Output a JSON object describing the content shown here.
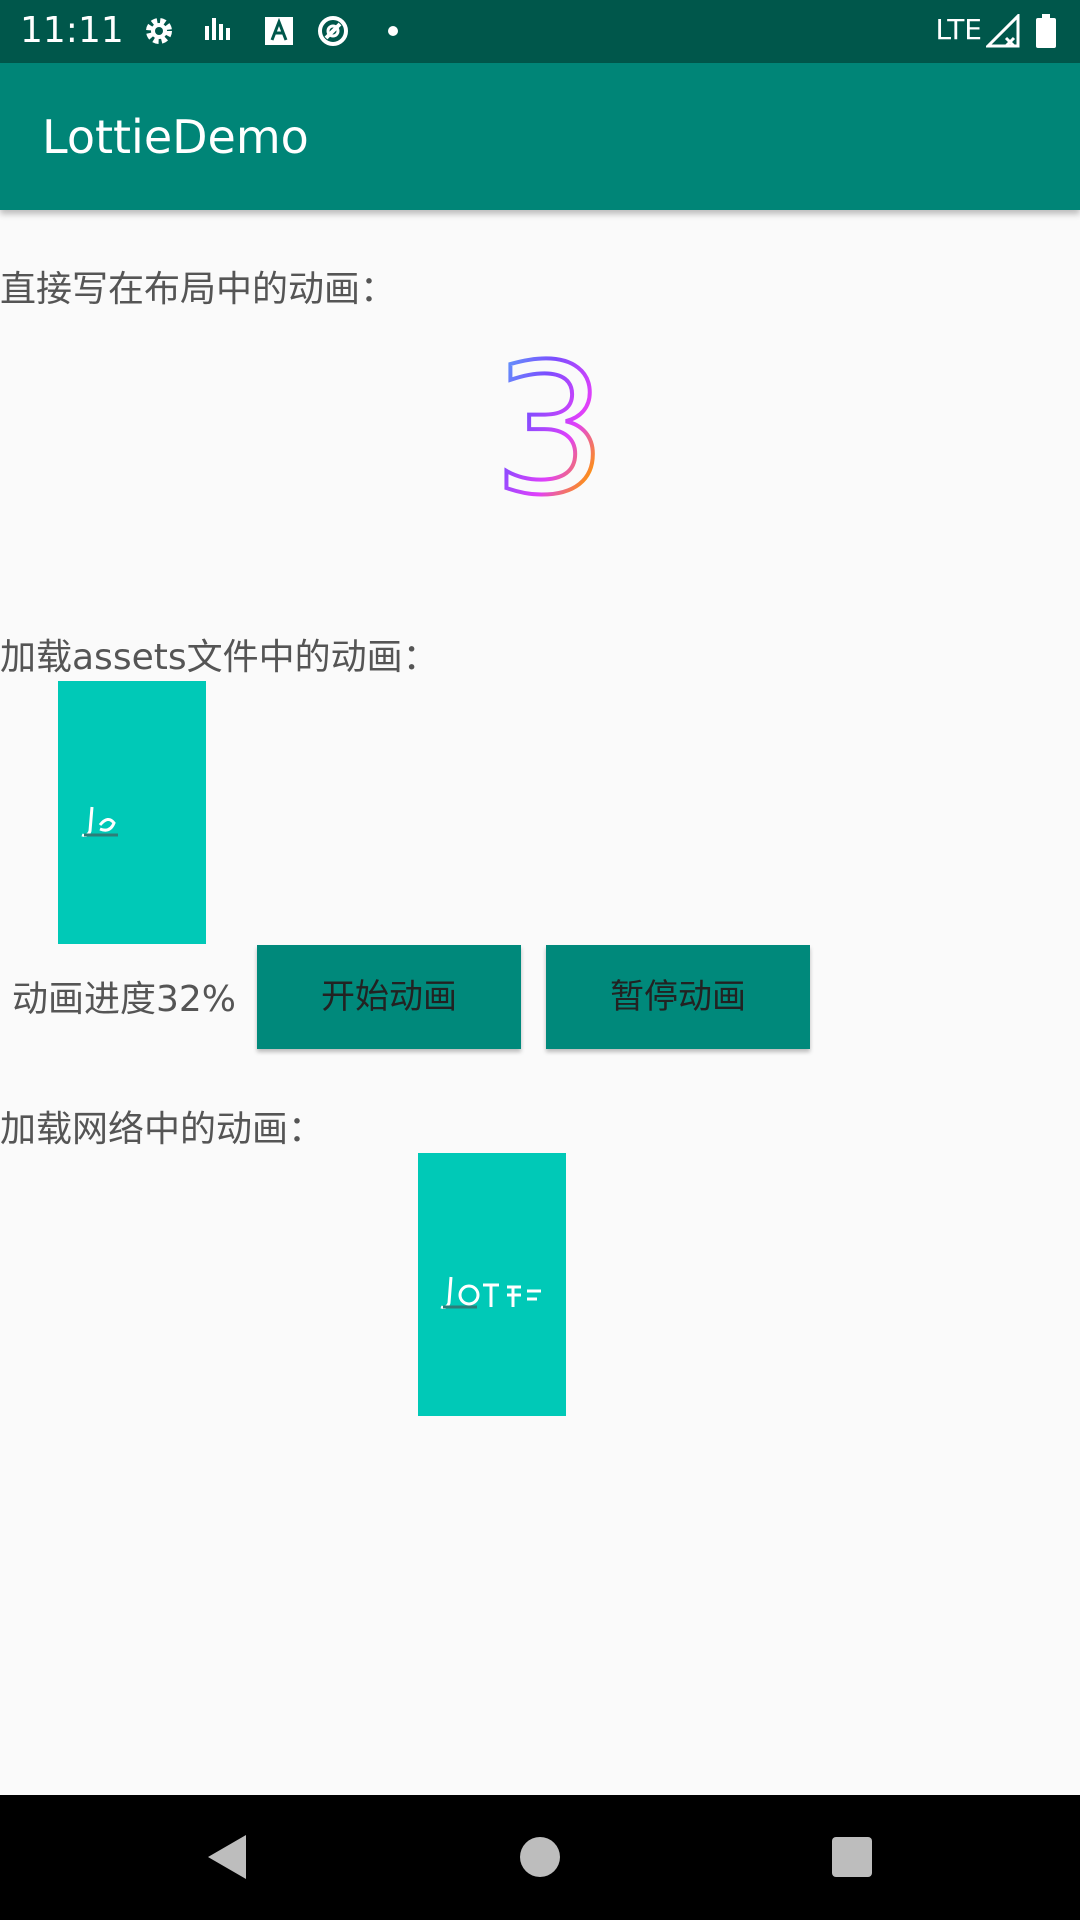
{
  "status_bar": {
    "time": "11:11",
    "network": "LTE",
    "icons": [
      "gear-icon",
      "signal-bars-icon",
      "a-box-icon",
      "sync-icon",
      "dot-icon",
      "cell-signal-icon",
      "battery-icon"
    ]
  },
  "app_bar": {
    "title": "LottieDemo"
  },
  "sections": {
    "layout_label": "直接写在布局中的动画：",
    "layout_anim_digit": "3",
    "assets_label": "加载assets文件中的动画：",
    "network_label": "加载网络中的动画："
  },
  "controls": {
    "progress_text": "动画进度32%",
    "progress": 0.32,
    "start_label": "开始动画",
    "pause_label": "暂停动画"
  },
  "nav_bar": {
    "icons": [
      "back-icon",
      "home-icon",
      "recents-icon"
    ]
  },
  "colors": {
    "status_bar": "#00574b",
    "app_bar": "#008577",
    "teal_box": "#00c9b7",
    "button": "#00897b"
  }
}
